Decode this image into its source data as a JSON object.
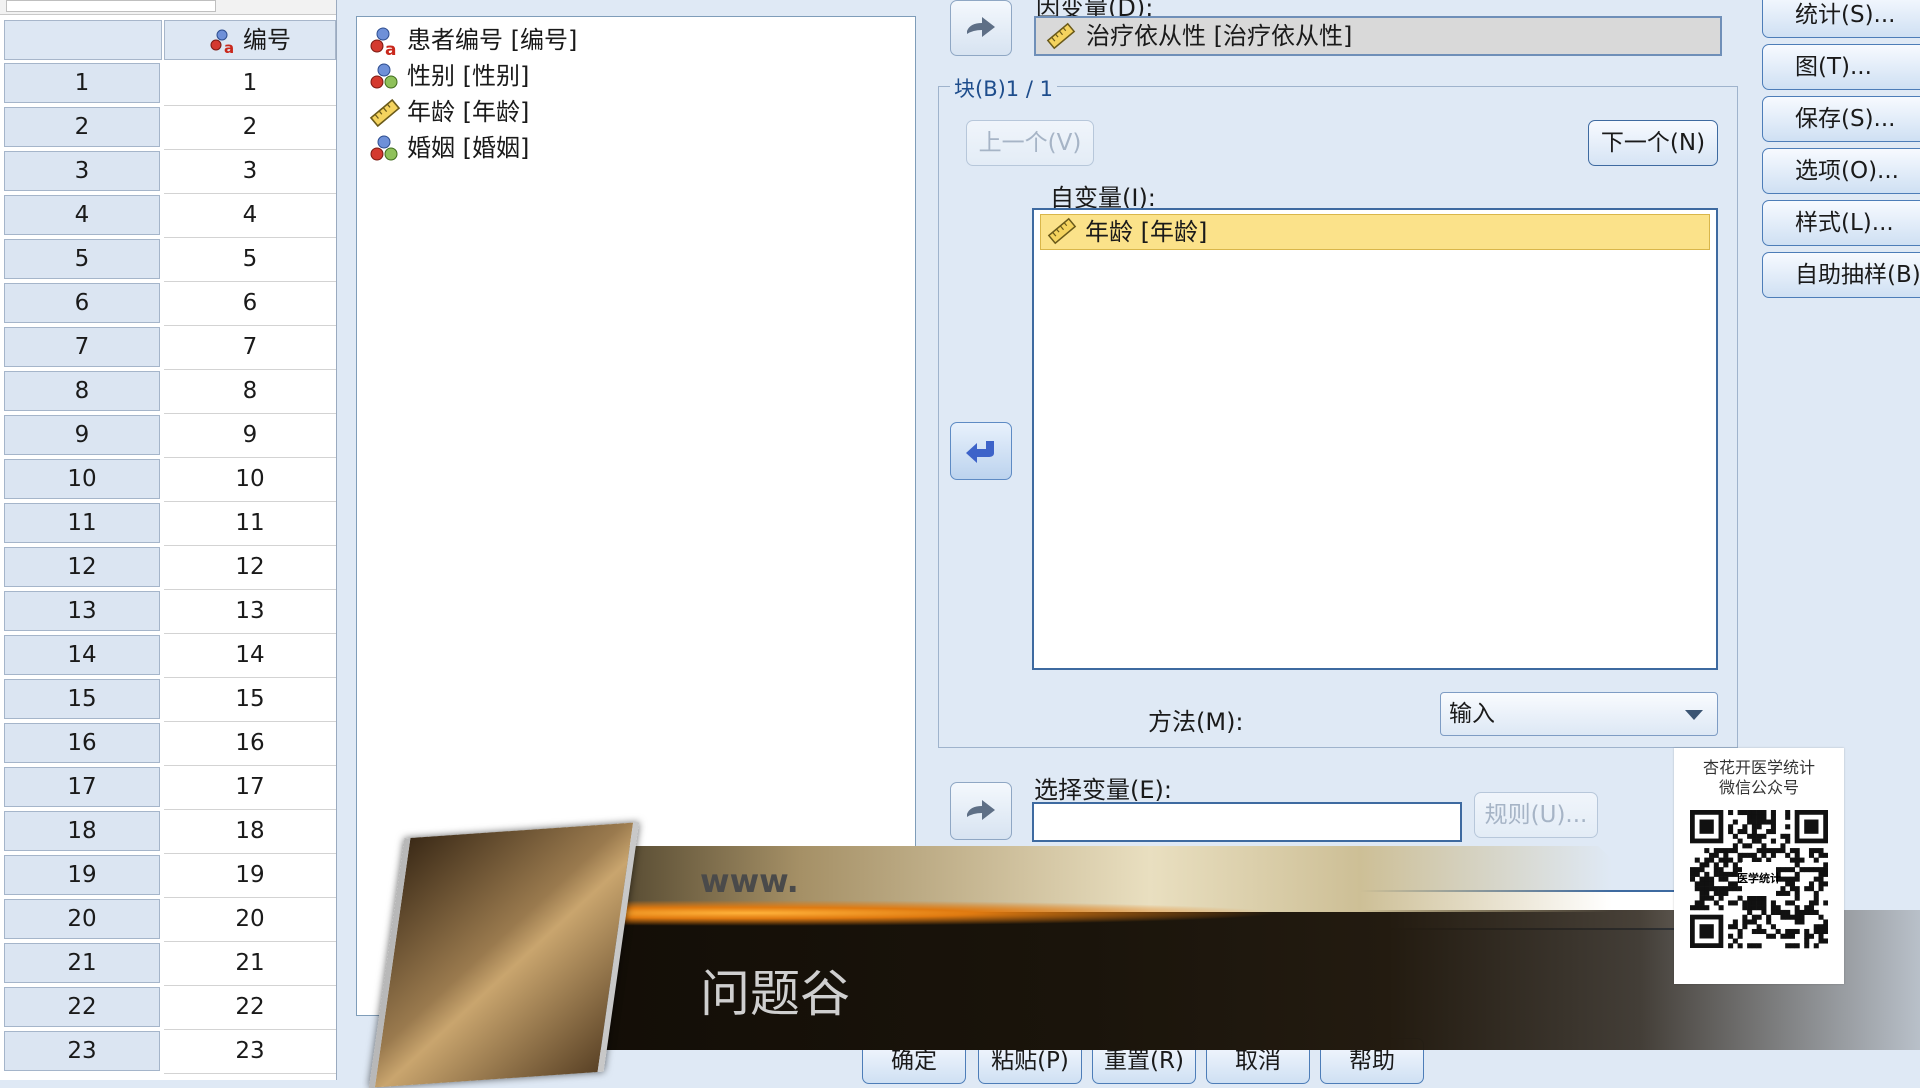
{
  "grid": {
    "top_cell_text": "",
    "column_header": "编号",
    "rows": [
      {
        "num": "1",
        "val": "1"
      },
      {
        "num": "2",
        "val": "2"
      },
      {
        "num": "3",
        "val": "3"
      },
      {
        "num": "4",
        "val": "4"
      },
      {
        "num": "5",
        "val": "5"
      },
      {
        "num": "6",
        "val": "6"
      },
      {
        "num": "7",
        "val": "7"
      },
      {
        "num": "8",
        "val": "8"
      },
      {
        "num": "9",
        "val": "9"
      },
      {
        "num": "10",
        "val": "10"
      },
      {
        "num": "11",
        "val": "11"
      },
      {
        "num": "12",
        "val": "12"
      },
      {
        "num": "13",
        "val": "13"
      },
      {
        "num": "14",
        "val": "14"
      },
      {
        "num": "15",
        "val": "15"
      },
      {
        "num": "16",
        "val": "16"
      },
      {
        "num": "17",
        "val": "17"
      },
      {
        "num": "18",
        "val": "18"
      },
      {
        "num": "19",
        "val": "19"
      },
      {
        "num": "20",
        "val": "20"
      },
      {
        "num": "21",
        "val": "21"
      },
      {
        "num": "22",
        "val": "22"
      },
      {
        "num": "23",
        "val": "23"
      }
    ]
  },
  "source_vars": [
    {
      "label": "患者编号 [编号]",
      "icon": "nominal-string-icon"
    },
    {
      "label": "性别 [性别]",
      "icon": "nominal-icon"
    },
    {
      "label": "年龄 [年龄]",
      "icon": "scale-ruler-icon"
    },
    {
      "label": "婚姻 [婚姻]",
      "icon": "nominal-icon"
    }
  ],
  "dependent": {
    "label": "因变量(D):",
    "value": "治疗依从性 [治疗依从性]"
  },
  "block": {
    "title": "块(B)1 / 1",
    "prev_button": "上一个(V)",
    "next_button": "下一个(N)",
    "independent_label": "自变量(I):",
    "independent_items": [
      "年龄 [年龄]"
    ],
    "method_label": "方法(M):",
    "method_value": "输入"
  },
  "selection": {
    "label": "选择变量(E):",
    "rule_button": "规则(U)...",
    "value": ""
  },
  "case_label_value": "",
  "side_buttons": [
    "统计(S)...",
    "图(T)...",
    "保存(S)...",
    "选项(O)...",
    "样式(L)...",
    "自助抽样(B)..."
  ],
  "bottom_buttons": [
    "确定",
    "粘贴(P)",
    "重置(R)",
    "取消",
    "帮助"
  ],
  "overlay": {
    "url_text": "www.",
    "title_text": "问题谷"
  },
  "qr": {
    "caption1": "杏花开医学统计",
    "caption2": "微信公众号",
    "center_text": "医学统计"
  },
  "colors": {
    "background": "#dfe9f5",
    "selected_item": "#fbe28a",
    "accent_border": "#3e6aa0",
    "arrow_active": "#3d63c9"
  }
}
